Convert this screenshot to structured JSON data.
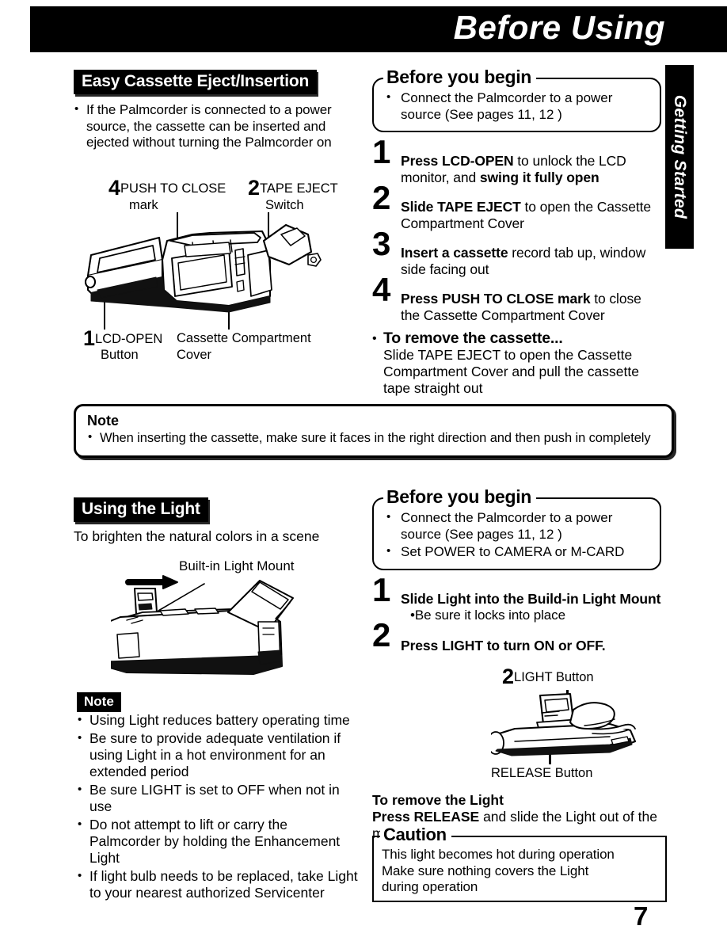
{
  "header": {
    "title": "Before Using",
    "side_tab": "Getting Started"
  },
  "page_number": "7",
  "section_cassette": {
    "title": "Easy Cassette Eject/Insertion",
    "intro_bullet": "If the Palmcorder is connected to a power source, the cassette can be inserted and ejected without turning the Palmcorder on",
    "figure": {
      "label_push_num": "4",
      "label_push_line1": "PUSH TO CLOSE",
      "label_push_line2": "mark",
      "label_tape_num": "2",
      "label_tape_line1": "TAPE EJECT",
      "label_tape_line2": "Switch",
      "label_lcd_num": "1",
      "label_lcd_line1": "LCD-OPEN",
      "label_lcd_line2": "Button",
      "label_cover_line1": "Cassette Compartment",
      "label_cover_line2": "Cover"
    },
    "before_you_begin": {
      "legend": "Before you begin",
      "bullets": [
        "Connect the Palmcorder to a power source  (See pages 11, 12 )"
      ]
    },
    "steps": [
      {
        "num": "1",
        "bold1": "Press LCD-OPEN",
        "plain1": " to unlock the LCD monitor, and ",
        "bold2": "swing it fully open",
        "plain2": ""
      },
      {
        "num": "2",
        "bold1": "Slide TAPE EJECT",
        "plain1": " to open the Cassette Compartment Cover",
        "bold2": "",
        "plain2": ""
      },
      {
        "num": "3",
        "bold1": "Insert a cassette",
        "plain1": " record tab up, window side facing out",
        "bold2": "",
        "plain2": ""
      },
      {
        "num": "4",
        "bold1": "Press PUSH TO CLOSE mark",
        "plain1": " to close the Cassette Compartment Cover",
        "bold2": "",
        "plain2": ""
      }
    ],
    "remove": {
      "title": "To remove the cassette...",
      "text": "Slide TAPE EJECT to open the Cassette Compartment Cover and pull the cassette tape straight out"
    },
    "note": {
      "title": "Note",
      "bullets": [
        "When inserting the cassette, make sure it faces in the right direction and then push in completely"
      ]
    }
  },
  "section_light": {
    "title": "Using the Light",
    "tagline": "To brighten the natural colors in a scene",
    "figure": {
      "label_mount": "Built-in Light Mount"
    },
    "before_you_begin": {
      "legend": "Before you begin",
      "bullets": [
        "Connect the Palmcorder to a power source  (See pages 11, 12 )",
        "Set POWER to CAMERA or M-CARD"
      ]
    },
    "steps": [
      {
        "num": "1",
        "bold1": "Slide Light into the Build-in Light Mount",
        "sub": "Be sure it locks into place"
      },
      {
        "num": "2",
        "bold1": "Press LIGHT to turn ON or OFF.",
        "sub": ""
      }
    ],
    "button_figure": {
      "light_num": "2",
      "light_label": "LIGHT Button",
      "release_label": "RELEASE Button"
    },
    "note": {
      "title": "Note",
      "bullets": [
        "Using Light reduces battery operating time",
        "Be sure to provide adequate ventilation if using Light in a hot environment for an extended period",
        "Be sure LIGHT is set to OFF when not in use",
        "Do not attempt to lift or carry the Palmcorder by holding the Enhancement Light",
        "If light bulb needs to be replaced, take Light to your nearest authorized Servicenter"
      ]
    },
    "remove_light": {
      "line1": "To remove the Light",
      "line2_bold": "Press RELEASE",
      "line2_plain": " and slide the Light out of the mount"
    },
    "caution": {
      "legend": "Caution",
      "lines": [
        "This light becomes hot during operation",
        "Make sure nothing covers the Light",
        "during operation"
      ]
    }
  },
  "colors": {
    "ink": "#000000",
    "paper": "#ffffff"
  }
}
